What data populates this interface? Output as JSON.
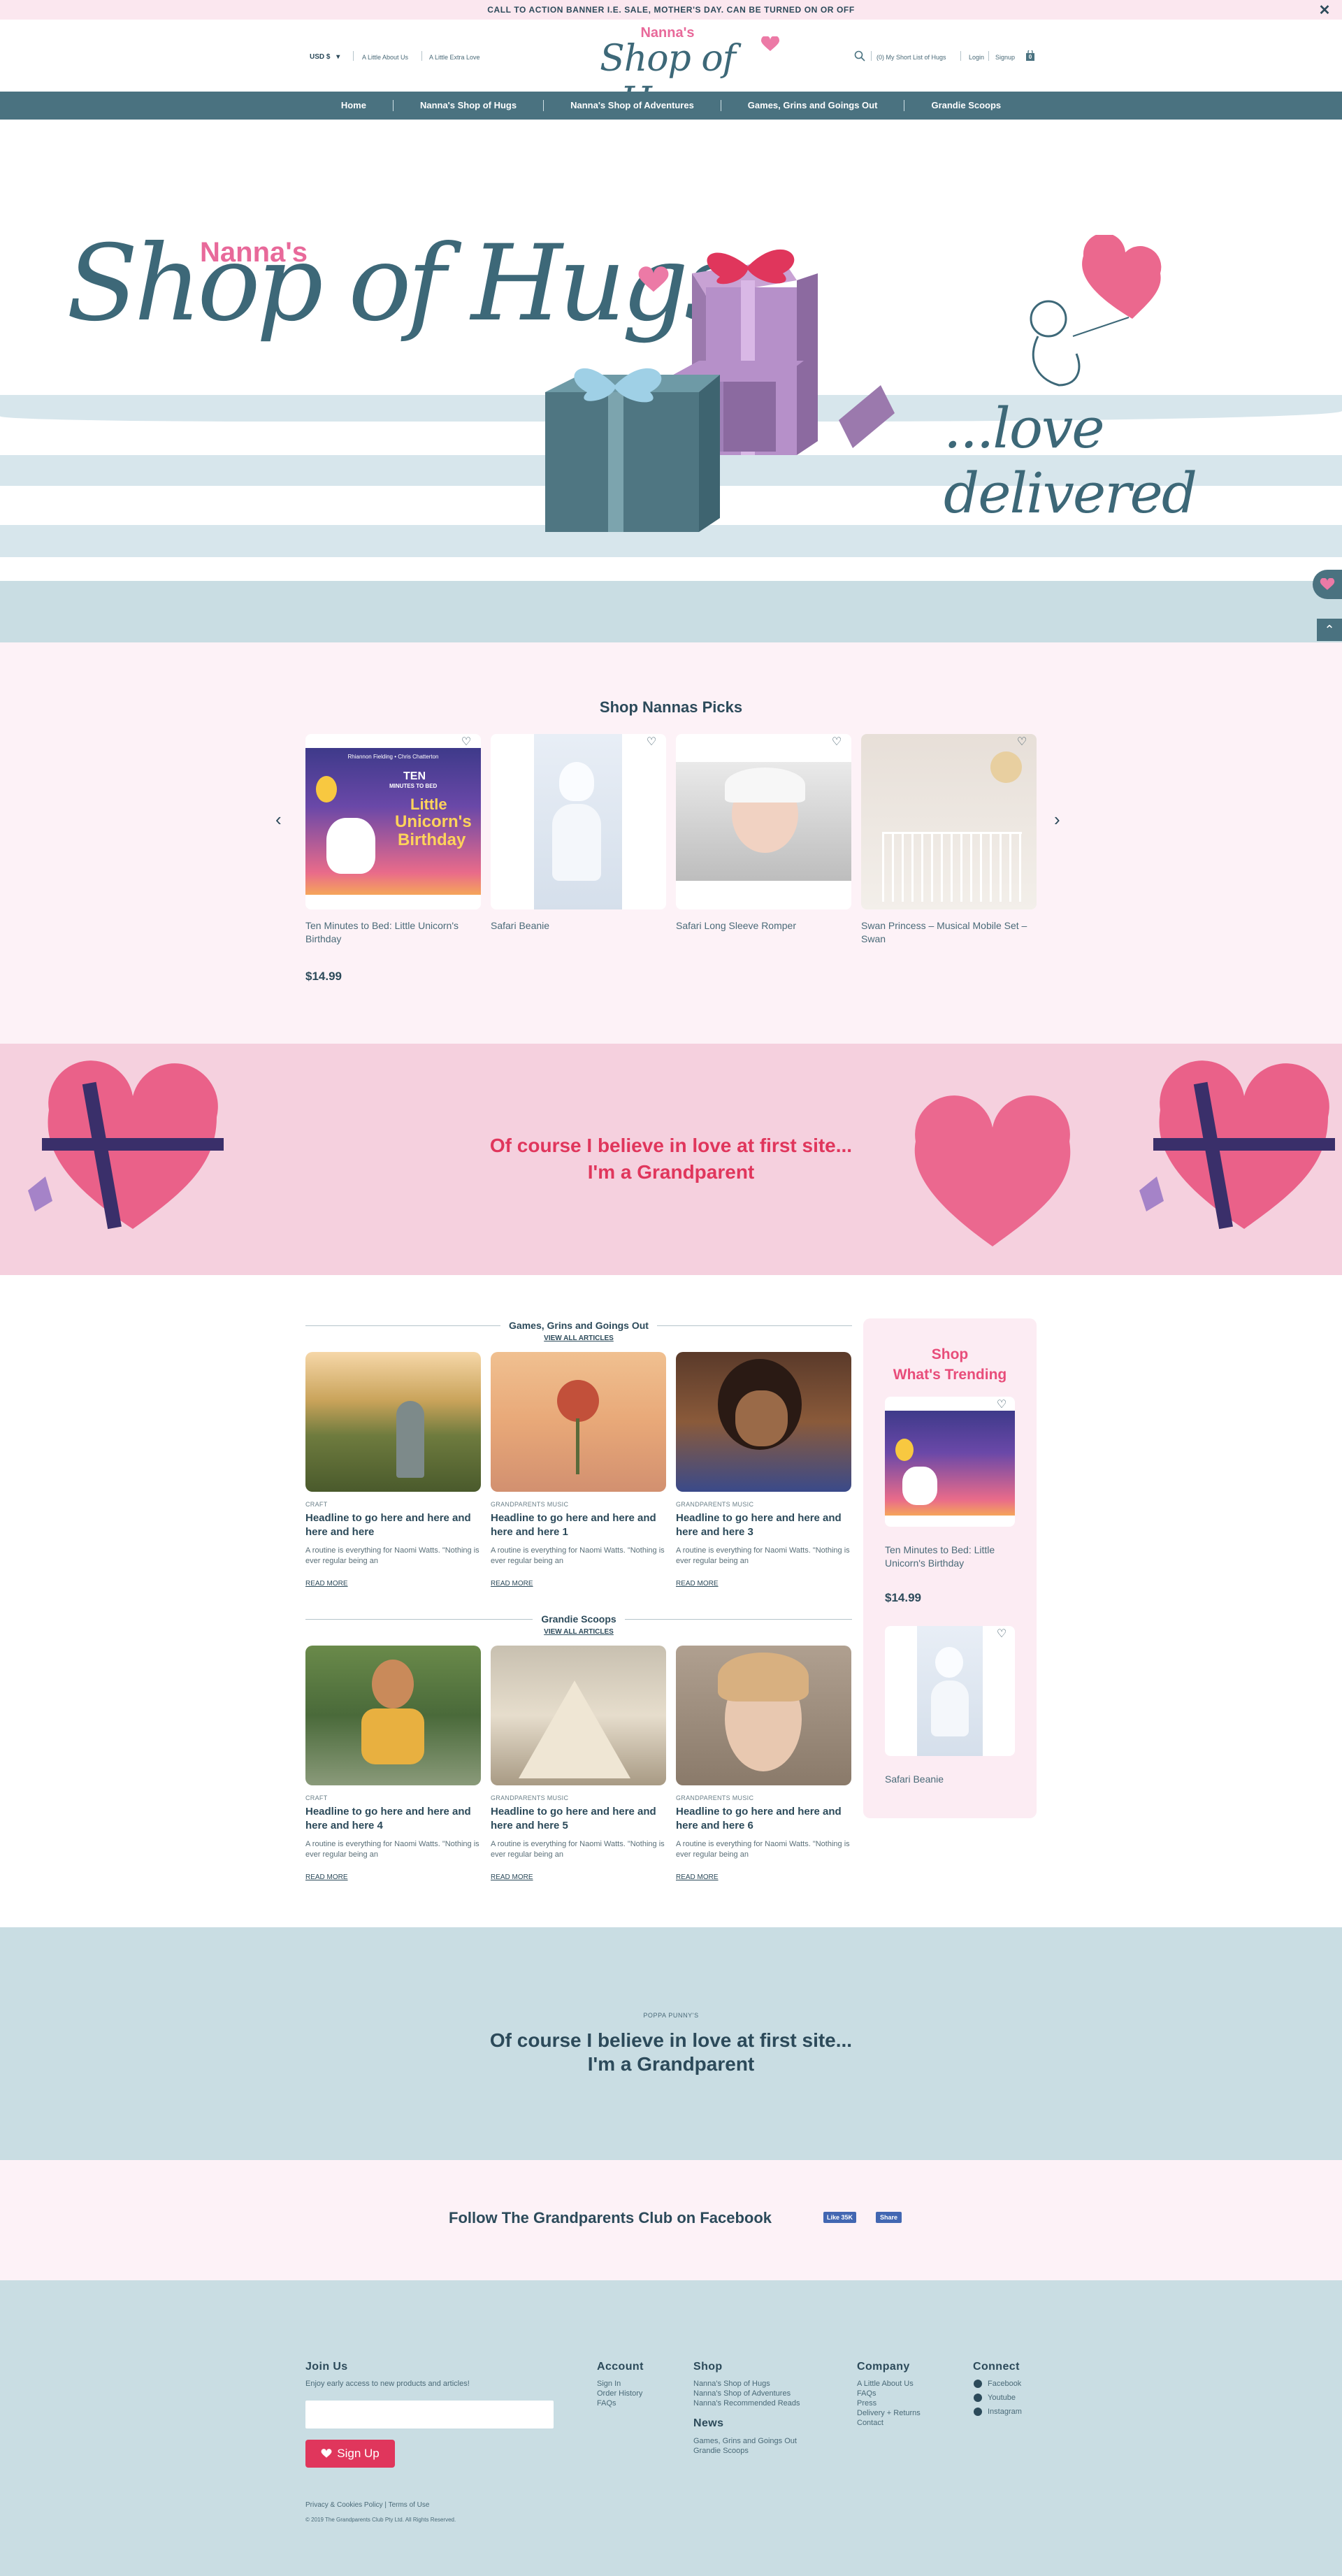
{
  "banner": {
    "text": "CALL TO ACTION BANNER I.E. SALE, MOTHER'S DAY. CAN BE TURNED ON OR OFF",
    "close": "✕"
  },
  "header": {
    "currency": "USD $",
    "links_left": [
      "A Little About Us",
      "A Little Extra Love"
    ],
    "logo_top": "Nanna's",
    "logo_main": "Shop of Hugs",
    "shortlist": "(0) My Short List of Hugs",
    "login": "Login",
    "signup": "Signup",
    "cart_count": "0"
  },
  "nav": [
    "Home",
    "Nanna's Shop of Hugs",
    "Nanna's Shop of Adventures",
    "Games, Grins and Goings Out",
    "Grandie Scoops"
  ],
  "hero": {
    "title_top": "Nanna's",
    "title_main": "Shop of Hugs",
    "tagline": "...love delivered"
  },
  "picks": {
    "title": "Shop Nannas Picks",
    "items": [
      {
        "title": "Ten Minutes to Bed: Little Unicorn's Birthday",
        "price": "$14.99",
        "cover_top": "Rhiannon Fielding • Chris Chatterton",
        "cover_title1": "TEN",
        "cover_title2": "MINUTES TO BED",
        "cover_title3": "Little",
        "cover_title4": "Unicorn's",
        "cover_title5": "Birthday"
      },
      {
        "title": "Safari Beanie",
        "price": ""
      },
      {
        "title": "Safari Long Sleeve Romper",
        "price": ""
      },
      {
        "title": "Swan Princess – Musical Mobile Set – Swan",
        "price": ""
      }
    ]
  },
  "love_banner": {
    "line1": "Of course I believe in love at first site...",
    "line2": "I'm a Grandparent"
  },
  "games": {
    "title": "Games, Grins and Goings Out",
    "viewall": "VIEW ALL ARTICLES",
    "articles": [
      {
        "cat": "CRAFT",
        "headline": "Headline to go here and here and here and here",
        "excerpt": "A routine is everything for Naomi Watts. \"Nothing is ever regular being an",
        "more": "READ MORE"
      },
      {
        "cat": "GRANDPARENTS MUSIC",
        "headline": "Headline to go here and here and here and here 1",
        "excerpt": "A routine is everything for Naomi Watts. \"Nothing is ever regular being an",
        "more": "READ MORE"
      },
      {
        "cat": "GRANDPARENTS MUSIC",
        "headline": "Headline to go here and here and here and here 3",
        "excerpt": "A routine is everything for Naomi Watts. \"Nothing is ever regular being an",
        "more": "READ MORE"
      }
    ]
  },
  "scoops": {
    "title": "Grandie Scoops",
    "viewall": "VIEW ALL ARTICLES",
    "articles": [
      {
        "cat": "CRAFT",
        "headline": "Headline to go here and here and here and here 4",
        "excerpt": "A routine is everything for Naomi Watts. \"Nothing is ever regular being an",
        "more": "READ MORE"
      },
      {
        "cat": "GRANDPARENTS MUSIC",
        "headline": "Headline to go here and here and here and here 5",
        "excerpt": "A routine is everything for Naomi Watts. \"Nothing is ever regular being an",
        "more": "READ MORE"
      },
      {
        "cat": "GRANDPARENTS MUSIC",
        "headline": "Headline to go here and here and here and here 6",
        "excerpt": "A routine is everything for Naomi Watts. \"Nothing is ever regular being an",
        "more": "READ MORE"
      }
    ]
  },
  "trending": {
    "title1": "Shop",
    "title2": "What's Trending",
    "items": [
      {
        "title": "Ten Minutes to Bed: Little Unicorn's Birthday",
        "price": "$14.99"
      },
      {
        "title": "Safari Beanie",
        "price": ""
      }
    ]
  },
  "quote": {
    "kicker": "POPPA PUNNY'S",
    "line1": "Of course I believe in love at first site...",
    "line2": "I'm a Grandparent"
  },
  "facebook": {
    "text": "Follow The Grandparents Club on Facebook",
    "like": "Like 35K",
    "share": "Share"
  },
  "footer": {
    "join": {
      "title": "Join Us",
      "text": "Enjoy early access to new products and articles!",
      "email_placeholder": "",
      "button": "Sign Up"
    },
    "account": {
      "title": "Account",
      "links": [
        "Sign In",
        "Order History",
        "FAQs"
      ]
    },
    "shop": {
      "title": "Shop",
      "links": [
        "Nanna's Shop of Hugs",
        "Nanna's Shop of Adventures",
        "Nanna's Recommended Reads"
      ]
    },
    "news": {
      "title": "News",
      "links": [
        "Games, Grins and Goings Out",
        "Grandie Scoops"
      ]
    },
    "company": {
      "title": "Company",
      "links": [
        "A Little About Us",
        "FAQs",
        "Press",
        "Delivery + Returns",
        "Contact"
      ]
    },
    "connect": {
      "title": "Connect",
      "links": [
        "Facebook",
        "Youtube",
        "Instagram"
      ]
    },
    "legal": "Privacy & Cookies Policy | Terms of Use",
    "copyright": "© 2019 The Grandparents Club Pty Ltd. All Rights Reserved."
  },
  "colors": {
    "teal": "#4a7280",
    "navy": "#2c4a5a",
    "pink": "#e84d7a",
    "blush": "#fdf2f7",
    "rose_banner": "#f5d0de",
    "sky": "#c9dde3"
  }
}
